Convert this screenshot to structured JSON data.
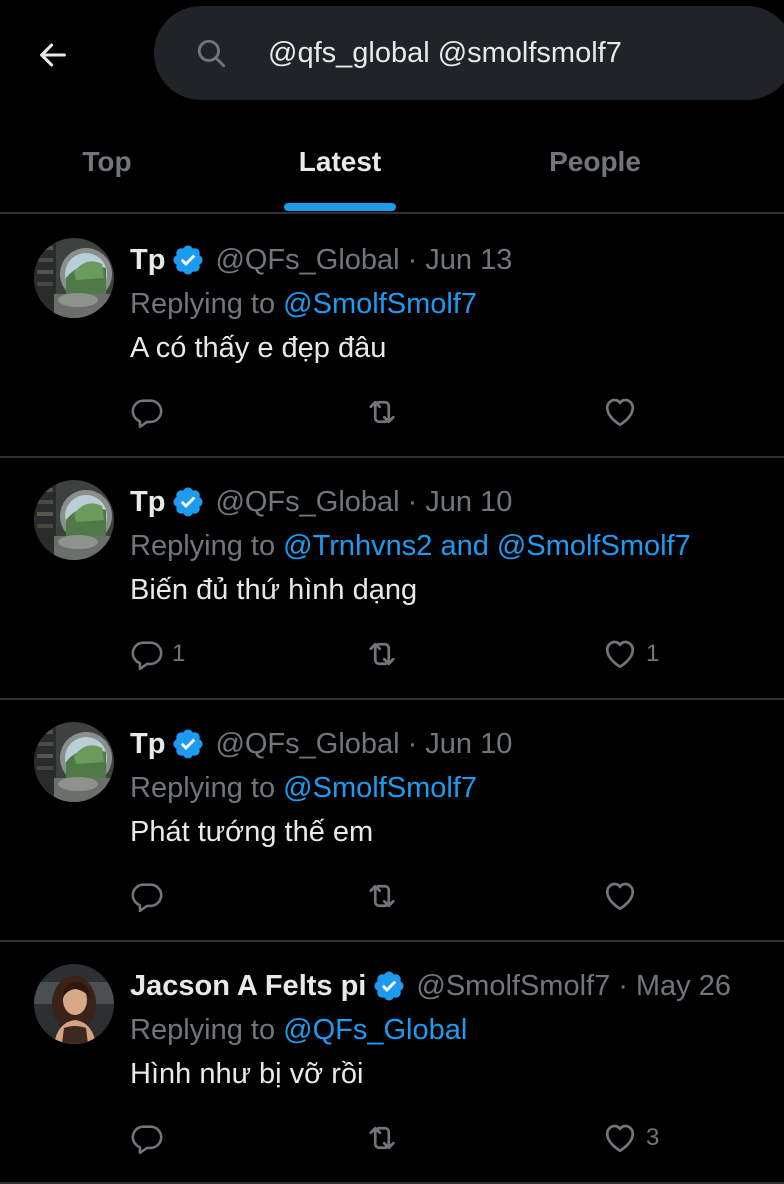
{
  "search": {
    "query": "@qfs_global @smolfsmolf7"
  },
  "tabs": [
    {
      "label": "Top"
    },
    {
      "label": "Latest"
    },
    {
      "label": "People"
    }
  ],
  "colors": {
    "accent": "#1d9bf0",
    "muted": "#71767b",
    "text": "#e7e9ea",
    "background": "#000000"
  },
  "icons": {
    "back": "arrow-left-icon",
    "search": "search-icon",
    "verified": "verified-badge-icon",
    "reply": "reply-icon",
    "retweet": "retweet-icon",
    "like": "heart-icon"
  },
  "tweets": [
    {
      "name": "Tp",
      "handle": "@QFs_Global",
      "dot": "·",
      "date": "Jun 13",
      "replying_prefix": "Replying to ",
      "mention1": "@SmolfSmolf7",
      "mention_join": "",
      "mention2": "",
      "text": "A có thấy e đẹp đâu",
      "replies": "",
      "retweets": "",
      "likes": ""
    },
    {
      "name": "Tp",
      "handle": "@QFs_Global",
      "dot": "·",
      "date": "Jun 10",
      "replying_prefix": "Replying to ",
      "mention1": "@Trnhvns2",
      "mention_join": " and ",
      "mention2": "@SmolfSmolf7",
      "text": "Biến đủ thứ hình dạng",
      "replies": "1",
      "retweets": "",
      "likes": "1"
    },
    {
      "name": "Tp",
      "handle": "@QFs_Global",
      "dot": "·",
      "date": "Jun 10",
      "replying_prefix": "Replying to ",
      "mention1": "@SmolfSmolf7",
      "mention_join": "",
      "mention2": "",
      "text": "Phát tướng thế em",
      "replies": "",
      "retweets": "",
      "likes": ""
    },
    {
      "name": "Jacson A Felts pi",
      "handle": "@SmolfSmolf7",
      "dot": "·",
      "date": "May 26",
      "replying_prefix": "Replying to ",
      "mention1": "@QFs_Global",
      "mention_join": "",
      "mention2": "",
      "text": "Hình như bị vỡ rồi",
      "replies": "",
      "retweets": "",
      "likes": "3"
    }
  ]
}
